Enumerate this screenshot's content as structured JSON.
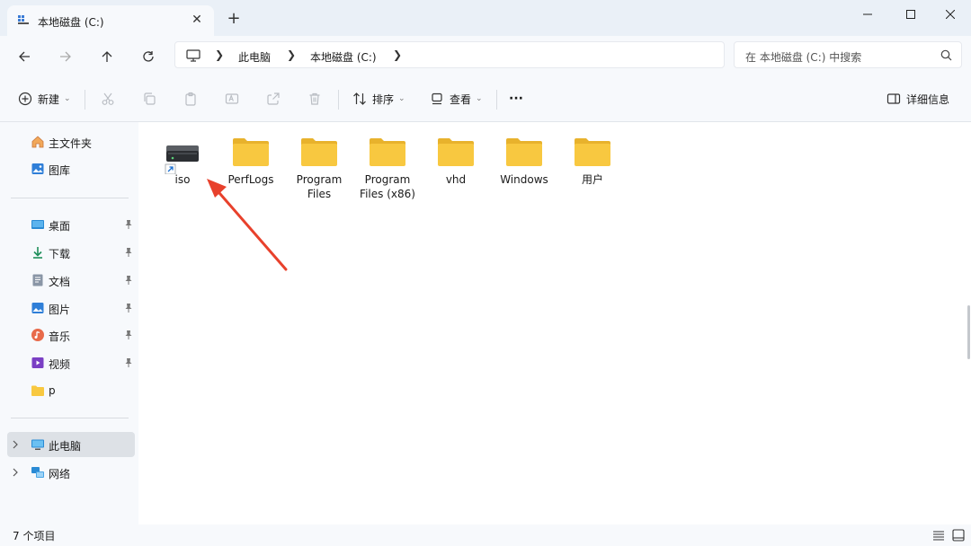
{
  "window": {
    "tab_title": "本地磁盘 (C:)",
    "close_tab": "✕",
    "new_tab": "+"
  },
  "address": {
    "crumbs": [
      "此电脑",
      "本地磁盘 (C:)"
    ]
  },
  "search": {
    "placeholder": "在 本地磁盘 (C:) 中搜索"
  },
  "toolbar": {
    "new_label": "新建",
    "sort_label": "排序",
    "view_label": "查看",
    "more_label": "···",
    "details_label": "详细信息"
  },
  "sidebar": {
    "top": [
      {
        "label": "主文件夹",
        "icon": "home-icon"
      },
      {
        "label": "图库",
        "icon": "gallery-icon"
      }
    ],
    "pinned": [
      {
        "label": "桌面",
        "icon": "desktop-icon"
      },
      {
        "label": "下载",
        "icon": "download-icon"
      },
      {
        "label": "文档",
        "icon": "document-icon"
      },
      {
        "label": "图片",
        "icon": "pictures-icon"
      },
      {
        "label": "音乐",
        "icon": "music-icon"
      },
      {
        "label": "视频",
        "icon": "video-icon"
      },
      {
        "label": "p",
        "icon": "folder-icon"
      }
    ],
    "devices": [
      {
        "label": "此电脑",
        "icon": "this-pc-icon",
        "selected": true
      },
      {
        "label": "网络",
        "icon": "network-icon",
        "selected": false
      }
    ]
  },
  "items": [
    {
      "name": "iso",
      "type": "drive-shortcut"
    },
    {
      "name": "PerfLogs",
      "type": "folder"
    },
    {
      "name": "Program Files",
      "type": "folder"
    },
    {
      "name": "Program Files (x86)",
      "type": "folder"
    },
    {
      "name": "vhd",
      "type": "folder"
    },
    {
      "name": "Windows",
      "type": "folder"
    },
    {
      "name": "用户",
      "type": "folder"
    }
  ],
  "status": {
    "count_text": "7 个项目"
  },
  "colors": {
    "accent": "#0067c0",
    "folder": "#f8c840",
    "annotation_arrow": "#e8412c",
    "selected_bg": "#dde1e6"
  }
}
